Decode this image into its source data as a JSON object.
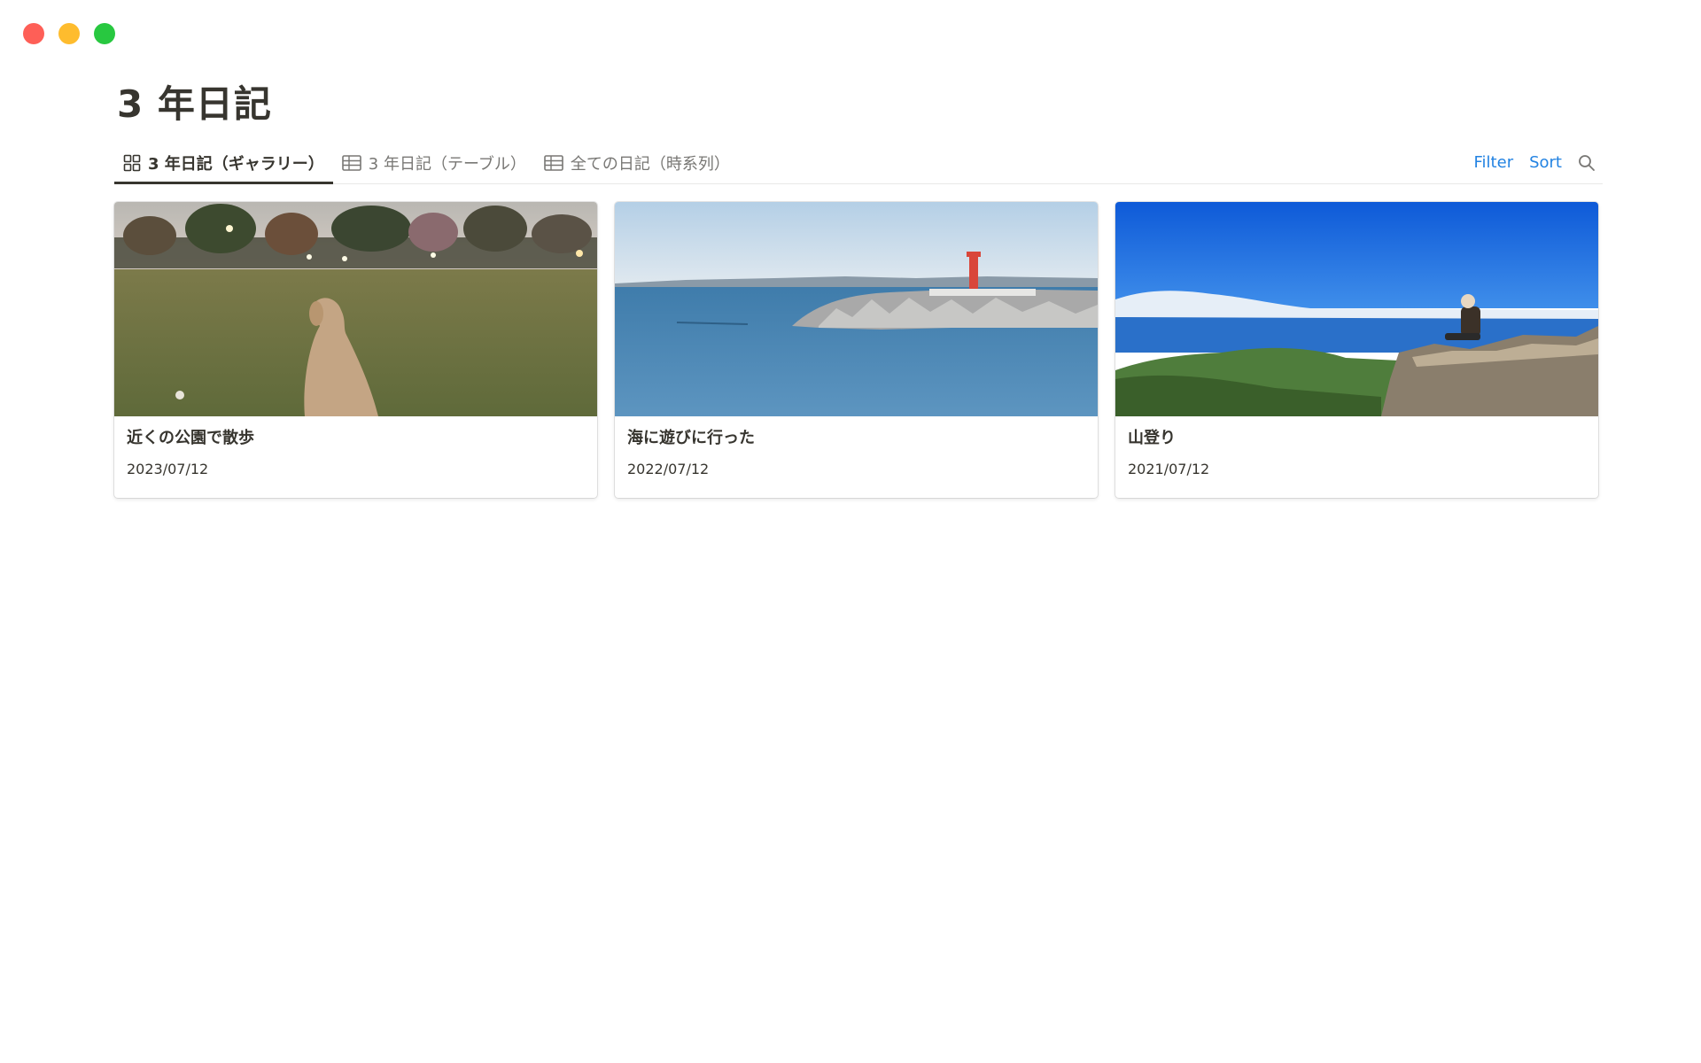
{
  "window": {
    "controls": {
      "close_color": "#fe5f57",
      "minimize_color": "#febc2e",
      "maximize_color": "#28c840"
    }
  },
  "page": {
    "title": "3 年日記"
  },
  "views": {
    "tabs": [
      {
        "label": "3 年日記（ギャラリー）",
        "icon": "gallery-icon",
        "active": true
      },
      {
        "label": "3 年日記（テーブル）",
        "icon": "table-icon",
        "active": false
      },
      {
        "label": "全ての日記（時系列）",
        "icon": "table-icon",
        "active": false
      }
    ],
    "filter_label": "Filter",
    "sort_label": "Sort",
    "search_icon": "search-icon",
    "accent_color": "#2383e2"
  },
  "gallery": {
    "cards": [
      {
        "title": "近くの公園で散歩",
        "date": "2023/07/12",
        "cover": "park-photo"
      },
      {
        "title": "海に遊びに行った",
        "date": "2022/07/12",
        "cover": "sea-photo"
      },
      {
        "title": "山登り",
        "date": "2021/07/12",
        "cover": "mountain-photo"
      }
    ]
  }
}
